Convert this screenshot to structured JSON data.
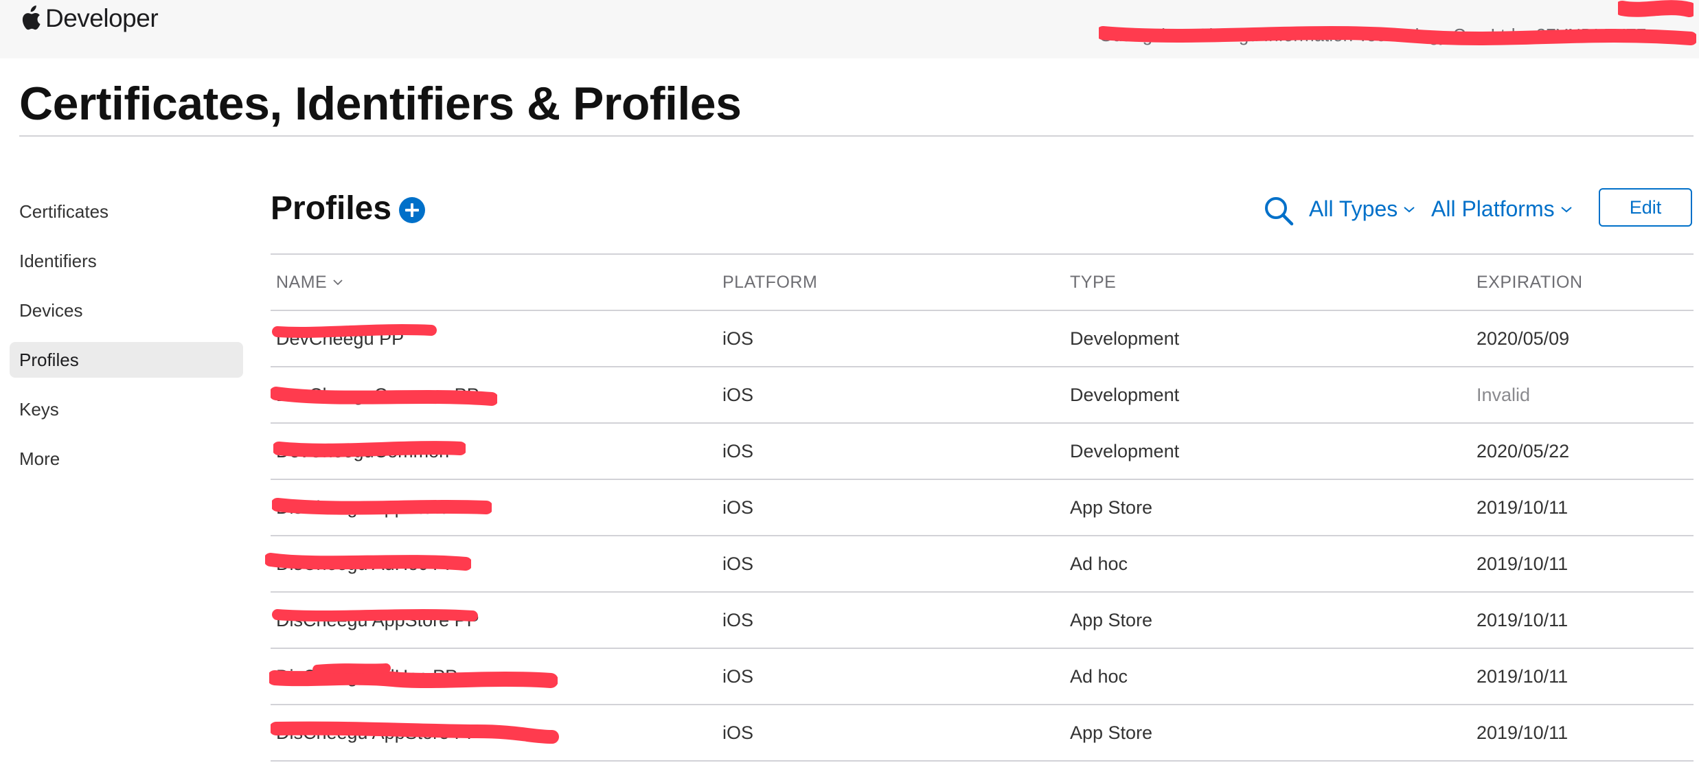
{
  "header": {
    "brand_label": "Developer",
    "account_line": "Guangzhou Cheegu Information Technology Co., Ltd. - 37YNDL5YZ7"
  },
  "page_title": "Certificates, Identifiers & Profiles",
  "sidebar": {
    "items": [
      {
        "label": "Certificates"
      },
      {
        "label": "Identifiers"
      },
      {
        "label": "Devices"
      },
      {
        "label": "Profiles"
      },
      {
        "label": "Keys"
      },
      {
        "label": "More"
      }
    ],
    "active": "Profiles"
  },
  "section": {
    "title": "Profiles",
    "filter_types": "All Types",
    "filter_platforms": "All Platforms",
    "edit_label": "Edit"
  },
  "table": {
    "columns": [
      "NAME",
      "PLATFORM",
      "TYPE",
      "EXPIRATION"
    ],
    "rows": [
      {
        "name": "DevCheegu PP",
        "platform": "iOS",
        "type": "Development",
        "expiration": "2020/05/09"
      },
      {
        "name": "DevCheeguCommon PP",
        "platform": "iOS",
        "type": "Development",
        "expiration": "Invalid"
      },
      {
        "name": "DevCheeguCommon",
        "platform": "iOS",
        "type": "Development",
        "expiration": "2020/05/22"
      },
      {
        "name": "DisCheegu AppStore PP",
        "platform": "iOS",
        "type": "App Store",
        "expiration": "2019/10/11"
      },
      {
        "name": "DisCheegu AdHoc PP",
        "platform": "iOS",
        "type": "Ad hoc",
        "expiration": "2019/10/11"
      },
      {
        "name": "DisCheegu AppStore PP",
        "platform": "iOS",
        "type": "App Store",
        "expiration": "2019/10/11"
      },
      {
        "name": "DisCheegu AdHoc PP",
        "platform": "iOS",
        "type": "Ad hoc",
        "expiration": "2019/10/11"
      },
      {
        "name": "DisCheegu AppStore PP",
        "platform": "iOS",
        "type": "App Store",
        "expiration": "2019/10/11"
      }
    ]
  },
  "colors": {
    "accent": "#0070c9",
    "redaction": "#ff3b4e",
    "active_bg": "#ebebeb",
    "divider": "#d2d2d7"
  },
  "icons": {
    "brand": "apple-logo-icon",
    "add": "plus-circle-icon",
    "search": "search-icon",
    "dropdown": "chevron-down-icon"
  }
}
